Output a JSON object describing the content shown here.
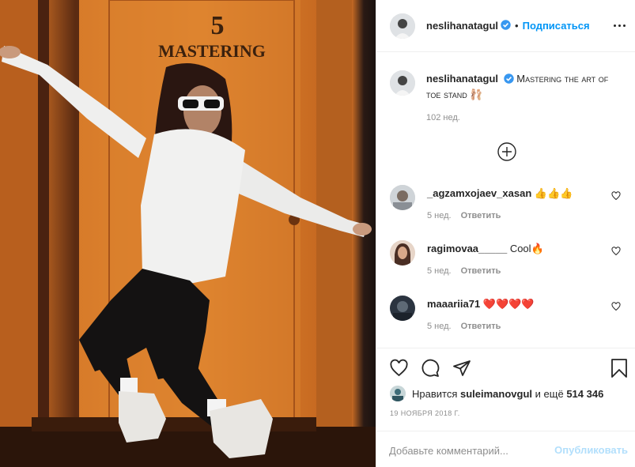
{
  "photo": {
    "door_number": "5",
    "door_sign": "MASTERING"
  },
  "header": {
    "username": "neslihanatagul",
    "separator": "•",
    "follow_label": "Подписаться"
  },
  "caption": {
    "username": "neslihanatagul",
    "text": "Mastering the art of toe stand",
    "emoji": "🩰",
    "time": "102 нед."
  },
  "comments": [
    {
      "username": "_agzamxojaev_xasan",
      "text": "👍👍👍",
      "time": "5 нед.",
      "reply": "Ответить"
    },
    {
      "username": "ragimovaa_____",
      "text": "Cool🔥",
      "time": "5 нед.",
      "reply": "Ответить"
    },
    {
      "username": "maaariia71",
      "text": "❤️❤️❤️❤️",
      "time": "5 нед.",
      "reply": "Ответить"
    }
  ],
  "likes": {
    "prefix": "Нравится",
    "liker": "suleimanovgul",
    "connector": "и ещё",
    "count": "514 346"
  },
  "date": "19 ноября 2018 г.",
  "add_comment": {
    "placeholder": "Добавьте комментарий...",
    "publish_label": "Опубликовать"
  },
  "colors": {
    "accent": "#0095f6",
    "verified": "#3897f0",
    "publish_disabled": "#b2dffc",
    "muted": "#8e8e8e"
  },
  "icons": [
    "more-icon",
    "verified-icon",
    "load-more-icon",
    "heart-icon",
    "comment-icon",
    "share-icon",
    "bookmark-icon"
  ]
}
